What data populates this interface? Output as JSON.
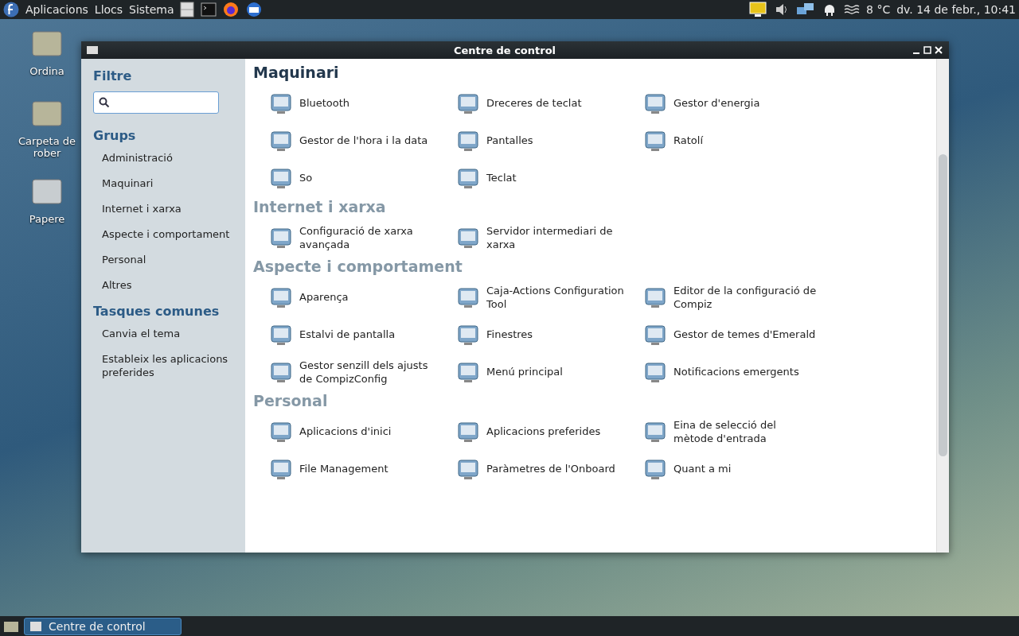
{
  "top_panel": {
    "menus": [
      "Aplicacions",
      "Llocs",
      "Sistema"
    ],
    "weather": "8 °C",
    "clock": "dv. 14 de febr., 10:41"
  },
  "desktop_icons": [
    {
      "label": "Ordina"
    },
    {
      "label": "Carpeta de\nrober"
    },
    {
      "label": "Papere"
    }
  ],
  "window": {
    "title": "Centre de control",
    "sidebar": {
      "filter_title": "Filtre",
      "groups_title": "Grups",
      "groups": [
        "Administració",
        "Maquinari",
        "Internet i xarxa",
        "Aspecte i comportament",
        "Personal",
        "Altres"
      ],
      "tasks_title": "Tasques comunes",
      "tasks": [
        "Canvia el tema",
        "Estableix les aplicacions preferides"
      ]
    },
    "sections": [
      {
        "title": "Maquinari",
        "selected": true,
        "items": [
          "Bluetooth",
          "Dreceres de teclat",
          "Gestor d'energia",
          "Gestor de l'hora i la data",
          "Pantalles",
          "Ratolí",
          "So",
          "Teclat"
        ]
      },
      {
        "title": "Internet i xarxa",
        "selected": false,
        "items": [
          "Configuració de xarxa avançada",
          "Servidor intermediari de xarxa"
        ]
      },
      {
        "title": "Aspecte i comportament",
        "selected": false,
        "items": [
          "Aparença",
          "Caja-Actions Configuration Tool",
          "Editor de la configuració de Compiz",
          "Estalvi de pantalla",
          "Finestres",
          "Gestor de temes d'Emerald",
          "Gestor senzill dels ajusts de CompizConfig",
          "Menú principal",
          "Notificacions emergents"
        ]
      },
      {
        "title": "Personal",
        "selected": false,
        "items": [
          "Aplicacions d'inici",
          "Aplicacions preferides",
          "Eina de selecció del mètode d'entrada",
          "File Management",
          "Paràmetres de l'Onboard",
          "Quant a mi"
        ]
      }
    ]
  },
  "taskbar": {
    "tasks": [
      {
        "label": "Centre de control",
        "selected": true
      }
    ]
  }
}
